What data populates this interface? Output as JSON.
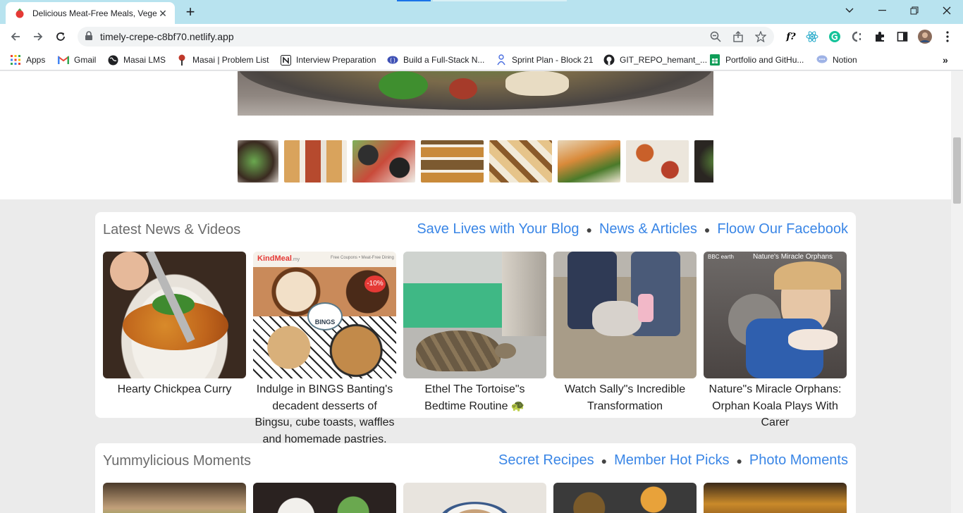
{
  "browser": {
    "tab_title": "Delicious Meat-Free Meals, Vege",
    "url": "timely-crepe-c8bf70.netlify.app",
    "bookmarks": [
      {
        "label": "Apps"
      },
      {
        "label": "Gmail"
      },
      {
        "label": "Masai LMS"
      },
      {
        "label": "Masai | Problem List"
      },
      {
        "label": "Interview Preparation"
      },
      {
        "label": "Build a Full-Stack N..."
      },
      {
        "label": "Sprint Plan - Block 21"
      },
      {
        "label": "GIT_REPO_hemant_..."
      },
      {
        "label": "Portfolio and GitHu..."
      },
      {
        "label": "Notion"
      }
    ],
    "ext_label": "f?"
  },
  "news": {
    "heading": "Latest News & Videos",
    "links": [
      "Save Lives with Your Blog",
      "News & Articles",
      "Floow Our Facebook"
    ],
    "items": [
      {
        "caption": "Hearty Chickpea Curry"
      },
      {
        "caption": "Indulge in BINGS Banting's decadent desserts of Bingsu, cube toasts, waffles and homemade pastries.",
        "brand": "KindMeal",
        "brand_suffix": ".my",
        "promo_text": "Free Coupons • Meat-Free Dining",
        "badge": "-10%",
        "logo": "BINGS"
      },
      {
        "caption": "Ethel The Tortoise\"s Bedtime Routine 🐢"
      },
      {
        "caption": "Watch Sally\"s Incredible Transformation"
      },
      {
        "caption": "Nature\"s Miracle Orphans: Orphan Koala Plays With Carer",
        "overlay_brand": "BBC earth",
        "overlay_title": "Nature's Miracle Orphans"
      }
    ]
  },
  "moments": {
    "heading": "Yummylicious Moments",
    "links": [
      "Secret Recipes",
      "Member Hot Picks",
      "Photo Moments"
    ]
  },
  "colors": {
    "link": "#3a86e6",
    "titlebar": "#b8e3ef"
  }
}
